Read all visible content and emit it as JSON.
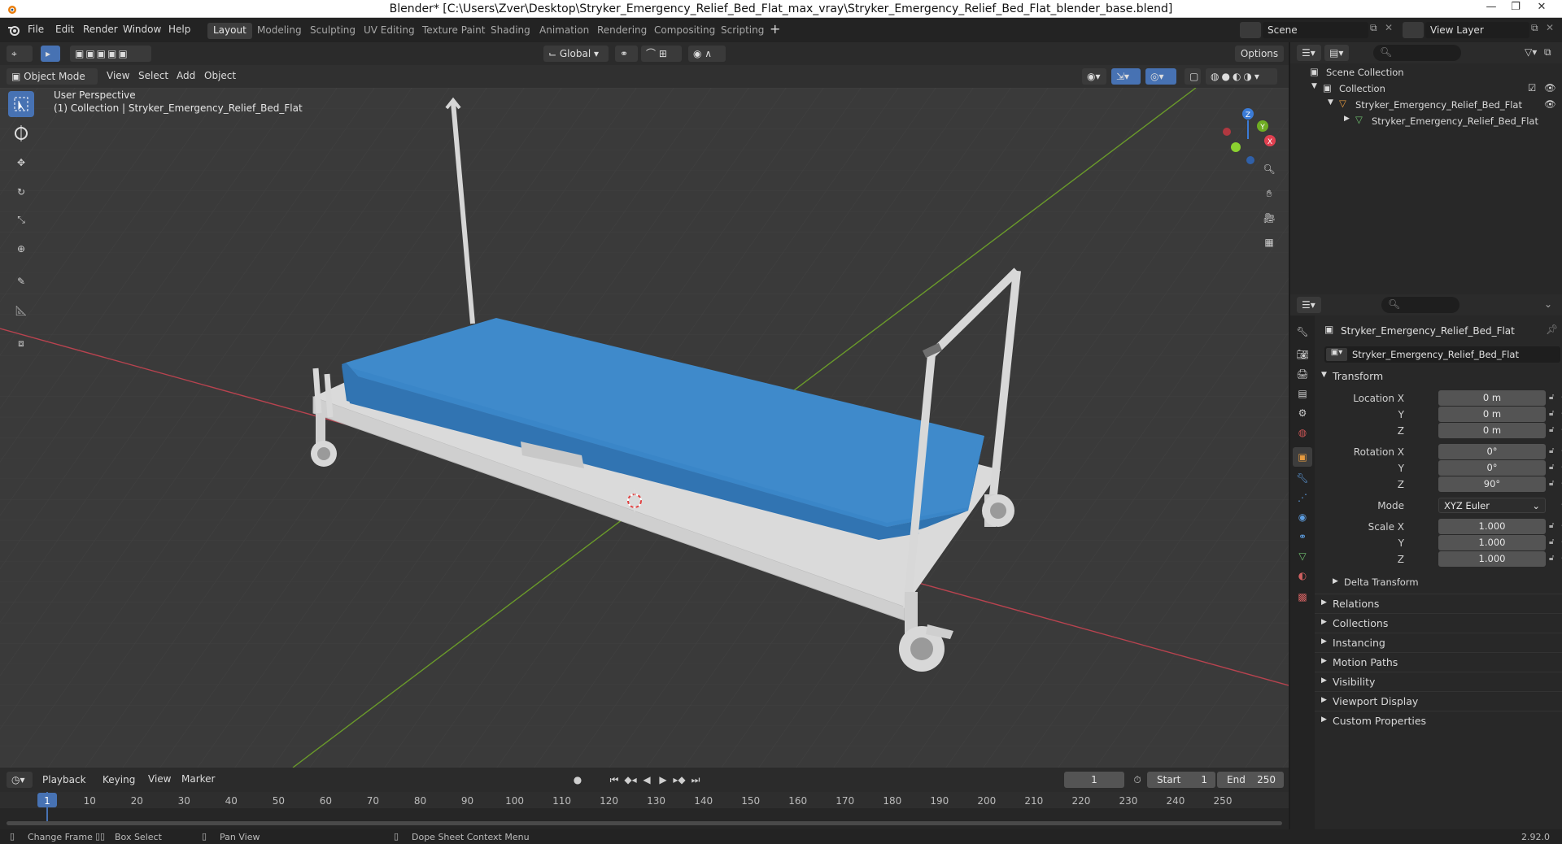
{
  "window": {
    "title": "Blender* [C:\\Users\\Zver\\Desktop\\Stryker_Emergency_Relief_Bed_Flat_max_vray\\Stryker_Emergency_Relief_Bed_Flat_blender_base.blend]"
  },
  "menu": [
    "File",
    "Edit",
    "Render",
    "Window",
    "Help"
  ],
  "workspaces": [
    "Layout",
    "Modeling",
    "Sculpting",
    "UV Editing",
    "Texture Paint",
    "Shading",
    "Animation",
    "Rendering",
    "Compositing",
    "Scripting"
  ],
  "scene": {
    "label": "Scene",
    "view_layer": "View Layer"
  },
  "viewport_header": {
    "mode": "Object Mode",
    "menus": [
      "View",
      "Select",
      "Add",
      "Object"
    ],
    "orientation": "Global",
    "options": "Options"
  },
  "viewport": {
    "perspective": "User Perspective",
    "collection_info": "(1) Collection | Stryker_Emergency_Relief_Bed_Flat"
  },
  "outliner": {
    "scene_collection": "Scene Collection",
    "collection": "Collection",
    "object": "Stryker_Emergency_Relief_Bed_Flat",
    "mesh": "Stryker_Emergency_Relief_Bed_Flat"
  },
  "properties": {
    "object_name": "Stryker_Emergency_Relief_Bed_Flat",
    "object_field": "Stryker_Emergency_Relief_Bed_Flat",
    "transform_label": "Transform",
    "location": {
      "label_x": "Location X",
      "label_y": "Y",
      "label_z": "Z",
      "x": "0 m",
      "y": "0 m",
      "z": "0 m"
    },
    "rotation": {
      "label_x": "Rotation X",
      "label_y": "Y",
      "label_z": "Z",
      "x": "0°",
      "y": "0°",
      "z": "90°"
    },
    "mode": {
      "label": "Mode",
      "value": "XYZ Euler"
    },
    "scale": {
      "label_x": "Scale X",
      "label_y": "Y",
      "label_z": "Z",
      "x": "1.000",
      "y": "1.000",
      "z": "1.000"
    },
    "delta_transform": "Delta Transform",
    "panels": [
      "Relations",
      "Collections",
      "Instancing",
      "Motion Paths",
      "Visibility",
      "Viewport Display",
      "Custom Properties"
    ]
  },
  "timeline": {
    "menus": [
      "Playback",
      "Keying",
      "View",
      "Marker"
    ],
    "current_frame": "1",
    "start_label": "Start",
    "start": "1",
    "end_label": "End",
    "end": "250",
    "ticks": [
      "1",
      "10",
      "20",
      "30",
      "40",
      "50",
      "60",
      "70",
      "80",
      "90",
      "100",
      "110",
      "120",
      "130",
      "140",
      "150",
      "160",
      "170",
      "180",
      "190",
      "200",
      "210",
      "220",
      "230",
      "240",
      "250"
    ]
  },
  "statusbar": {
    "change_frame": "Change Frame",
    "box_select": "Box Select",
    "pan_view": "Pan View",
    "context_menu": "Dope Sheet Context Menu",
    "version": "2.92.0"
  },
  "colors": {
    "accent": "#4772b3",
    "mattress": "#3a86c8",
    "frame": "#d9d9d9",
    "x_axis": "#c0404a",
    "y_axis": "#6a9a2a"
  }
}
